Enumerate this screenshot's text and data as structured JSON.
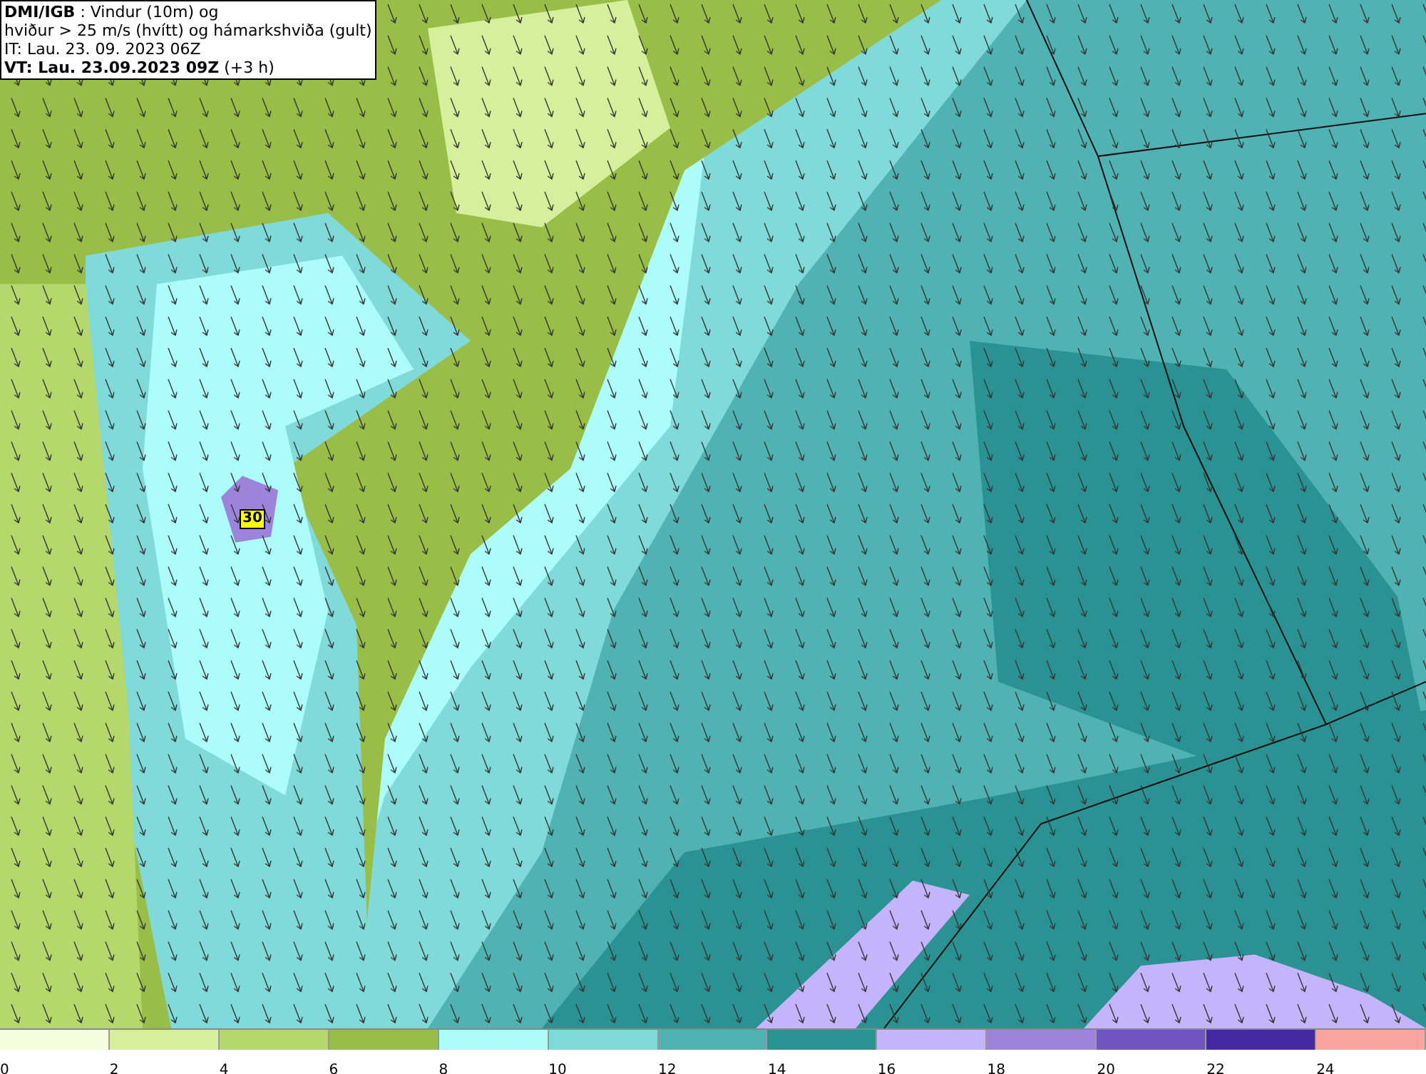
{
  "title_box": {
    "lines": [
      "**DMI/IGB** : Vindur (10m) og",
      "hviður > 25 m/s (hvítt) og hámarkshviða (gult)",
      "IT: Lau. 23. 09. 2023 06Z",
      "**VT: Lau. 23.09.2023 09Z** (+3 h)"
    ]
  },
  "map": {
    "gust_label": "30"
  },
  "legend": [
    {
      "color": "#f5fcdc",
      "label": "0"
    },
    {
      "color": "#d6ef9c",
      "label": "2"
    },
    {
      "color": "#b5d86c",
      "label": "4"
    },
    {
      "color": "#98be48",
      "label": "6"
    },
    {
      "color": "#adfcfc",
      "label": "8"
    },
    {
      "color": "#80dada",
      "label": "10"
    },
    {
      "color": "#50b2b2",
      "label": "12"
    },
    {
      "color": "#2a9292",
      "label": "14"
    },
    {
      "color": "#c4b4fc",
      "label": "16"
    },
    {
      "color": "#9c84dc",
      "label": "18"
    },
    {
      "color": "#7054c0",
      "label": "20"
    },
    {
      "color": "#4428a4",
      "label": "22"
    },
    {
      "color": "#fca4a0",
      "label": "24"
    }
  ]
}
